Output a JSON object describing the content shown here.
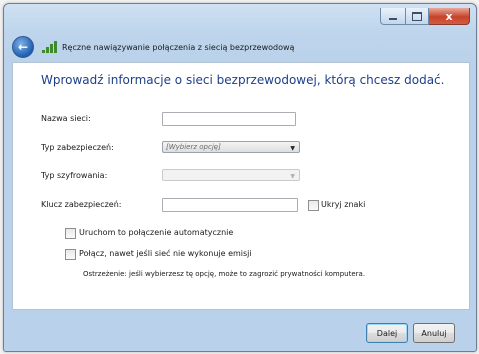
{
  "window": {
    "close_glyph": "x"
  },
  "header": {
    "back_glyph": "←",
    "title": "Ręczne nawiązywanie połączenia z siecią bezprzewodową"
  },
  "main": {
    "heading": "Wprowadź informacje o sieci bezprzewodowej, którą chcesz dodać.",
    "fields": {
      "network_name_label": "Nazwa sieci:",
      "network_name_value": "",
      "security_type_label": "Typ zabezpieczeń:",
      "security_type_value": "[Wybierz opcję]",
      "encryption_type_label": "Typ szyfrowania:",
      "encryption_type_value": "",
      "security_key_label": "Klucz zabezpieczeń:",
      "security_key_value": "",
      "hide_chars_label": "Ukryj znaki"
    },
    "options": {
      "auto_connect_label": "Uruchom to połączenie automatycznie",
      "connect_hidden_label": "Połącz, nawet jeśli sieć nie wykonuje emisji",
      "warning_text": "Ostrzeżenie: jeśli wybierzesz tę opcję, może to zagrozić prywatności komputera."
    }
  },
  "buttons": {
    "next_label": "Dalej",
    "cancel_label": "Anuluj"
  }
}
